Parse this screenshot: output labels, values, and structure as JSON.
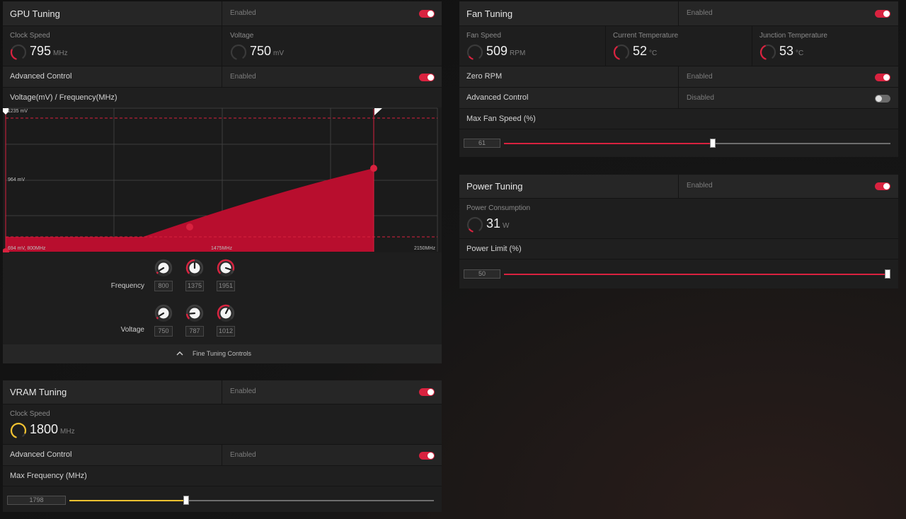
{
  "gpu_tuning": {
    "title": "GPU Tuning",
    "state": "Enabled",
    "clock_speed": {
      "label": "Clock Speed",
      "value": "795",
      "unit": "MHz",
      "gauge": 0.3
    },
    "voltage": {
      "label": "Voltage",
      "value": "750",
      "unit": "mV",
      "gauge": 0.0
    },
    "advanced_control": {
      "label": "Advanced Control",
      "state": "Enabled"
    },
    "curve_title": "Voltage(mV) / Frequency(MHz)",
    "graph_labels": {
      "top_left": "1235 mV",
      "mid_left": "964 mV",
      "bottom_left": "694 mV, 800MHz",
      "bottom_mid": "1475MHz",
      "bottom_right": "2150MHz"
    },
    "frequency_label": "Frequency",
    "voltage_label": "Voltage",
    "frequency_knobs": [
      {
        "value": "800",
        "level": 0.05
      },
      {
        "value": "1375",
        "level": 0.5
      },
      {
        "value": "1951",
        "level": 0.9
      }
    ],
    "voltage_knobs": [
      {
        "value": "750",
        "level": 0.05
      },
      {
        "value": "787",
        "level": 0.15
      },
      {
        "value": "1012",
        "level": 0.6
      }
    ],
    "fine_tuning_label": "Fine Tuning Controls"
  },
  "vram_tuning": {
    "title": "VRAM Tuning",
    "state": "Enabled",
    "clock_speed": {
      "label": "Clock Speed",
      "value": "1800",
      "unit": "MHz",
      "gauge": 0.9
    },
    "advanced_control": {
      "label": "Advanced Control",
      "state": "Enabled"
    },
    "max_frequency": {
      "label": "Max Frequency (MHz)",
      "value": "1798",
      "level": 0.32
    }
  },
  "fan_tuning": {
    "title": "Fan Tuning",
    "state": "Enabled",
    "fan_speed": {
      "label": "Fan Speed",
      "value": "509",
      "unit": "RPM",
      "gauge": 0.1
    },
    "current_temperature": {
      "label": "Current Temperature",
      "value": "52",
      "unit": "°C",
      "gauge": 0.4
    },
    "junction_temperature": {
      "label": "Junction Temperature",
      "value": "53",
      "unit": "°C",
      "gauge": 0.45
    },
    "zero_rpm": {
      "label": "Zero RPM",
      "state": "Enabled"
    },
    "advanced_control": {
      "label": "Advanced Control",
      "state": "Disabled"
    },
    "max_fan_speed": {
      "label": "Max Fan Speed (%)",
      "value": "61",
      "level": 0.54
    }
  },
  "power_tuning": {
    "title": "Power Tuning",
    "state": "Enabled",
    "power_consumption": {
      "label": "Power Consumption",
      "value": "31",
      "unit": "W",
      "gauge": 0.1
    },
    "power_limit": {
      "label": "Power Limit (%)",
      "value": "50",
      "level": 1.0
    }
  },
  "colors": {
    "accent_red": "#d9223f",
    "accent_yellow": "#f2c230",
    "curve_fill": "#b80e2e"
  }
}
